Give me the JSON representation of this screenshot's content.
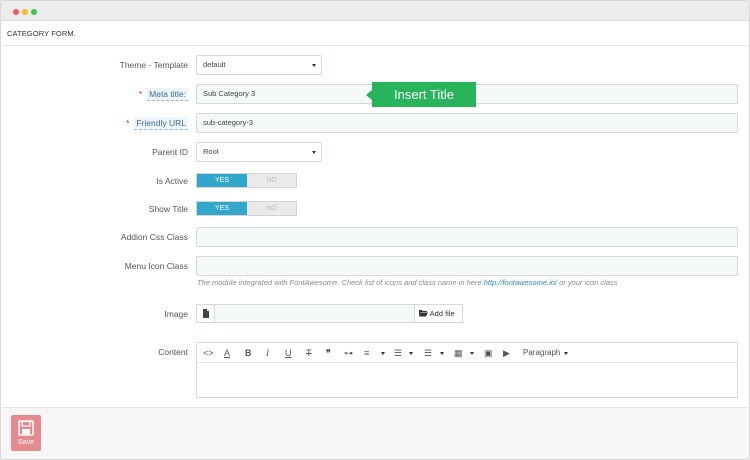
{
  "window": {
    "controls": [
      "close",
      "minimize",
      "maximize"
    ]
  },
  "panel": {
    "title": "CATEGORY FORM."
  },
  "fields": {
    "theme_template": {
      "label": "Theme - Template",
      "value": "default"
    },
    "meta_title": {
      "label": "Meta title:",
      "required": "*",
      "value": "Sub Category 3"
    },
    "friendly_url": {
      "label": "Friendly URL",
      "required": "*",
      "value": "sub-category-3"
    },
    "parent_id": {
      "label": "Parent ID",
      "value": "Root"
    },
    "is_active": {
      "label": "Is Active",
      "yes": "YES",
      "no": "NO",
      "selected": "YES"
    },
    "show_title": {
      "label": "Show Title",
      "yes": "YES",
      "no": "NO",
      "selected": "YES"
    },
    "addion_css_class": {
      "label": "Addion Css Class",
      "value": ""
    },
    "menu_icon_class": {
      "label": "Menu Icon Class",
      "value": "",
      "hint_prefix": "The module integrated with FontAwesome. Check list of icons and class name in here",
      "hint_link": "http://fontawesome.io/",
      "hint_suffix": "or your icon class"
    },
    "image": {
      "label": "Image",
      "add_file": "Add file"
    },
    "content": {
      "label": "Content",
      "paragraph": "Paragraph"
    }
  },
  "tooltip": {
    "text": "Insert Title",
    "color": "#27b45a"
  },
  "footer": {
    "save_label": "Save"
  },
  "colors": {
    "accent": "#31a7cc",
    "save": "#e58a8e",
    "required": "#ee2222"
  }
}
